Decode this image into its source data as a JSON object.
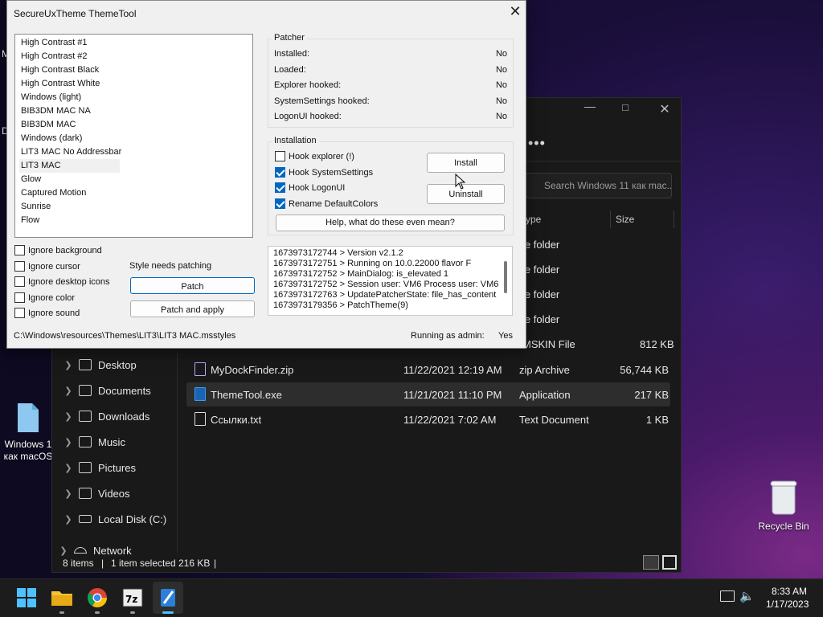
{
  "desktop": {
    "icon1_label": "Windows 1\nкак macOS",
    "recycle_label": "Recycle Bin",
    "left_fragments": [
      "M",
      "D"
    ]
  },
  "explorer": {
    "search_placeholder": "Search Windows 11 как mac...",
    "columns": {
      "type": "ype",
      "size": "Size"
    },
    "partial_rows": [
      "le folder",
      "le folder",
      "le folder",
      "le folder",
      "MSKIN File"
    ],
    "partial_sizes": [
      "",
      "",
      "",
      "",
      "812 KB"
    ],
    "nav": [
      {
        "label": "Desktop"
      },
      {
        "label": "Documents"
      },
      {
        "label": "Downloads"
      },
      {
        "label": "Music"
      },
      {
        "label": "Pictures"
      },
      {
        "label": "Videos"
      },
      {
        "label": "Local Disk (C:)"
      },
      {
        "label": "Network"
      }
    ],
    "files": [
      {
        "name": "MyDockFinder.zip",
        "date": "11/22/2021 12:19 AM",
        "type": "zip Archive",
        "size": "56,744 KB"
      },
      {
        "name": "ThemeTool.exe",
        "date": "11/21/2021 11:10 PM",
        "type": "Application",
        "size": "217 KB"
      },
      {
        "name": "Ссылки.txt",
        "date": "11/22/2021 7:02 AM",
        "type": "Text Document",
        "size": "1 KB"
      }
    ],
    "status": {
      "items": "8 items",
      "selected": "1 item selected",
      "size": "216 KB"
    }
  },
  "dialog": {
    "title": "SecureUxTheme ThemeTool",
    "themes": [
      "High Contrast #1",
      "High Contrast #2",
      "High Contrast Black",
      "High Contrast White",
      "Windows (light)",
      "BIB3DM MAC NA",
      "BIB3DM MAC",
      "Windows (dark)",
      "LIT3 MAC No Addressbar",
      "LIT3 MAC",
      "Glow",
      "Captured Motion",
      "Sunrise",
      "Flow"
    ],
    "options": [
      "Ignore background",
      "Ignore cursor",
      "Ignore desktop icons",
      "Ignore color",
      "Ignore sound"
    ],
    "style_status": "Style needs patching",
    "patch_label": "Patch",
    "patch_apply_label": "Patch and apply",
    "patcher": {
      "title": "Patcher",
      "rows": [
        {
          "label": "Installed:",
          "value": "No"
        },
        {
          "label": "Loaded:",
          "value": "No"
        },
        {
          "label": "Explorer hooked:",
          "value": "No"
        },
        {
          "label": "SystemSettings hooked:",
          "value": "No"
        },
        {
          "label": "LogonUI hooked:",
          "value": "No"
        }
      ]
    },
    "installation": {
      "title": "Installation",
      "hooks": [
        {
          "label": "Hook explorer (!)",
          "checked": false
        },
        {
          "label": "Hook SystemSettings",
          "checked": true
        },
        {
          "label": "Hook LogonUI",
          "checked": true
        },
        {
          "label": "Rename DefaultColors",
          "checked": true
        }
      ],
      "install_label": "Install",
      "uninstall_label": "Uninstall",
      "help_label": "Help, what do these even mean?"
    },
    "log": [
      "1673973172744 > Version v2.1.2",
      "1673973172751 > Running on 10.0.22000 flavor F",
      "1673973172752 > MainDialog: is_elevated 1",
      "1673973172752 > Session user: VM6 Process user: VM6",
      "1673973172763 > UpdatePatcherState: file_has_content",
      "1673973179356 > PatchTheme(9)"
    ],
    "path": "C:\\Windows\\resources\\Themes\\LIT3\\LIT3 MAC.msstyles",
    "admin_label": "Running as admin:",
    "admin_value": "Yes"
  },
  "taskbar": {
    "time": "8:33 AM",
    "date": "1/17/2023",
    "apps": [
      "start-icon",
      "file-explorer-icon",
      "chrome-icon",
      "7zip-icon",
      "themetool-icon"
    ]
  }
}
